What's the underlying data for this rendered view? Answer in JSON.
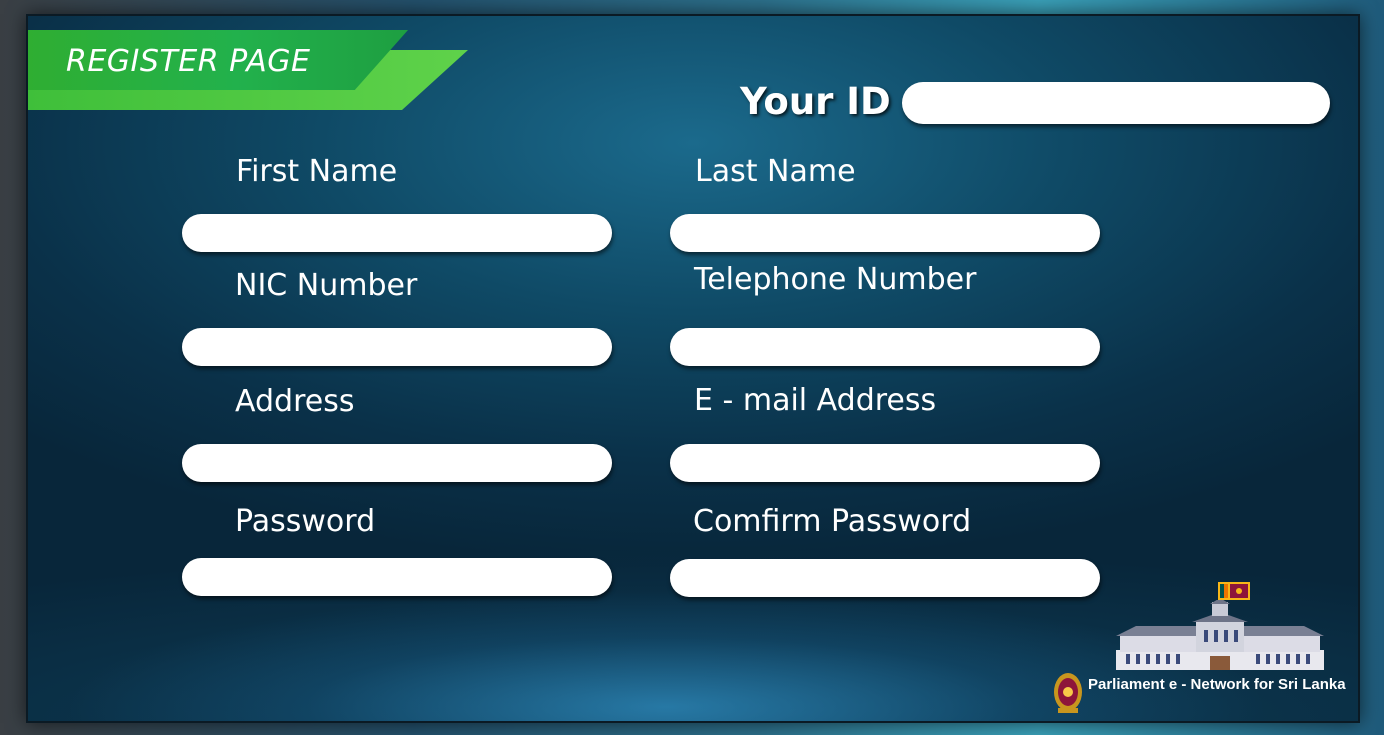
{
  "header": {
    "title": "REGISTER PAGE",
    "your_id_label": "Your ID",
    "your_id_value": ""
  },
  "form": {
    "first_name": {
      "label": "First Name",
      "value": ""
    },
    "last_name": {
      "label": "Last Name",
      "value": ""
    },
    "nic_number": {
      "label": "NIC Number",
      "value": ""
    },
    "telephone_number": {
      "label": "Telephone Number",
      "value": ""
    },
    "address": {
      "label": "Address",
      "value": ""
    },
    "email_address": {
      "label": "E - mail Address",
      "value": ""
    },
    "password": {
      "label": "Password",
      "value": ""
    },
    "confirm_password": {
      "label": "Comfirm Password",
      "value": ""
    }
  },
  "footer": {
    "brand_text": "Parliament e - Network for Sri Lanka"
  },
  "icons": {
    "flag": "sri-lanka-flag-icon",
    "building": "parliament-building-icon",
    "emblem": "national-emblem-icon"
  },
  "colors": {
    "banner_green": "#22b14c",
    "background_blue": "#0f4a66",
    "input_white": "#ffffff"
  }
}
